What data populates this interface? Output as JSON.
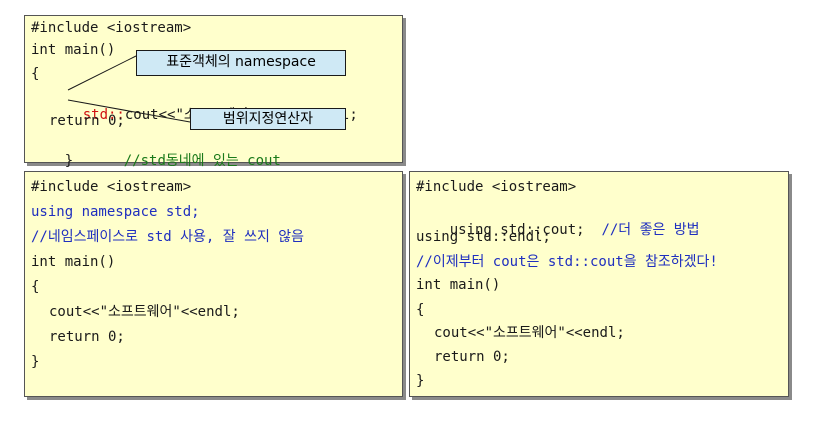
{
  "top_box": {
    "line1": "#include <iostream>",
    "line2": "int main()",
    "line3": "{",
    "line4_std": "std::",
    "line4_rest": "cout<<\"소프트웨어\"<<std::endl;",
    "line5": "return 0;",
    "line6_brace": "}",
    "line6_comment": "//std동네에 있는 cout"
  },
  "callouts": {
    "namespace": "표준객체의 namespace",
    "scope_op": "범위지정연산자"
  },
  "left_box": {
    "line1": "#include <iostream>",
    "line2": "using namespace std;",
    "line3": "//네임스페이스로 std 사용, 잘 쓰지 않음",
    "line4": "int main()",
    "line5": "{",
    "line6": "cout<<\"소프트웨어\"<<endl;",
    "line7": "return 0;",
    "line8": "}"
  },
  "right_box": {
    "line1": "#include <iostream>",
    "line2_code": "using std::cout;",
    "line2_comment": "//더 좋은 방법",
    "line3": "using std::endl;",
    "line4": "//이제부터 cout은 std::cout을 참조하겠다!",
    "line5": "int main()",
    "line6": "{",
    "line7": "cout<<\"소프트웨어\"<<endl;",
    "line8": "return 0;",
    "line9": "}"
  },
  "colors": {
    "box_bg": "#ffffcc",
    "callout_bg": "#cfe9f5",
    "keyword_blue": "#1f2fbf",
    "highlight_red": "#d01010",
    "comment_green": "#1a7a1a"
  }
}
